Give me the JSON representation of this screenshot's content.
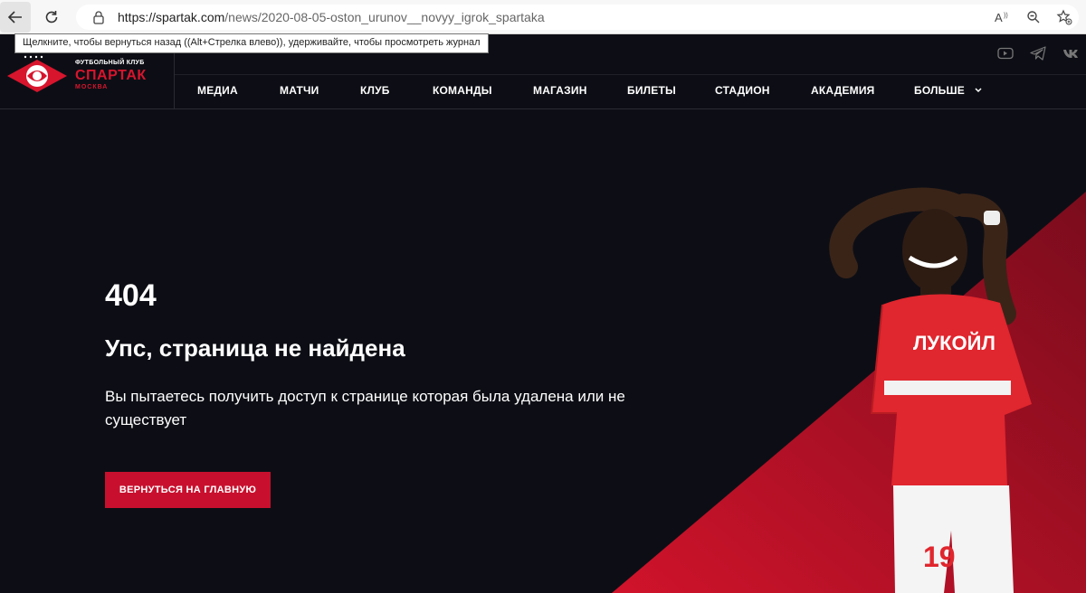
{
  "browser": {
    "url_host": "https://spartak.com",
    "url_path": "/news/2020-08-05-oston_urunov__novyy_igrok_spartaka",
    "tooltip": "Щелкните, чтобы вернуться назад ((Alt+Стрелка влево)), удерживайте, чтобы просмотреть журнал"
  },
  "logo": {
    "small": "ФУТБОЛЬНЫЙ КЛУБ",
    "big": "СПАРТАК",
    "city": "МОСКВА"
  },
  "menu": {
    "items": [
      "МЕДИА",
      "МАТЧИ",
      "КЛУБ",
      "КОМАНДЫ",
      "МАГАЗИН",
      "БИЛЕТЫ",
      "СТАДИОН",
      "АКАДЕМИЯ",
      "БОЛЬШЕ"
    ]
  },
  "error": {
    "code": "404",
    "title": "Упс, страница не найдена",
    "description": "Вы пытаетесь получить доступ к странице которая была удалена или не существует",
    "button": "ВЕРНУТЬСЯ НА ГЛАВНУЮ"
  },
  "player": {
    "shirt_sponsor": "ЛУКОЙЛ",
    "shirt_number": "19"
  },
  "colors": {
    "brand_red": "#c8102e",
    "background": "#0d0e15"
  },
  "icons": [
    "back-arrow-icon",
    "refresh-icon",
    "lock-icon",
    "read-aloud-icon",
    "zoom-icon",
    "favorites-icon",
    "youtube-icon",
    "telegram-icon",
    "vk-icon",
    "chevron-down-icon"
  ]
}
